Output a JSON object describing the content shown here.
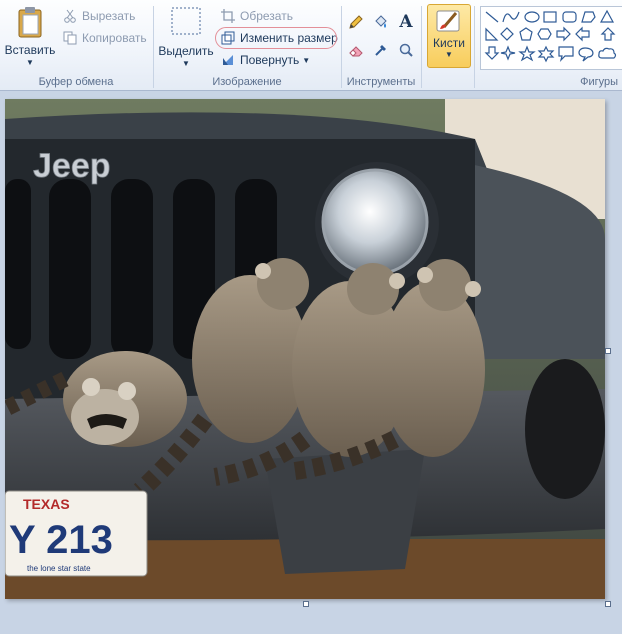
{
  "clipboard": {
    "paste_label": "Вставить",
    "cut_label": "Вырезать",
    "copy_label": "Копировать",
    "group_label": "Буфер обмена"
  },
  "image": {
    "select_label": "Выделить",
    "crop_label": "Обрезать",
    "resize_label": "Изменить размер",
    "rotate_label": "Повернуть",
    "group_label": "Изображение"
  },
  "tools": {
    "group_label": "Инструменты",
    "text_tool_glyph": "A"
  },
  "brushes": {
    "label": "Кисти"
  },
  "shapes": {
    "group_label": "Фигуры"
  },
  "canvas": {
    "plate_state": "TEXAS",
    "plate_number": "Y 213",
    "plate_footer": "the lone star state",
    "grille_brand": "Jeep"
  },
  "colors": {
    "accent_highlight": "#e38f98",
    "brush_active": "#f8cd5c"
  }
}
